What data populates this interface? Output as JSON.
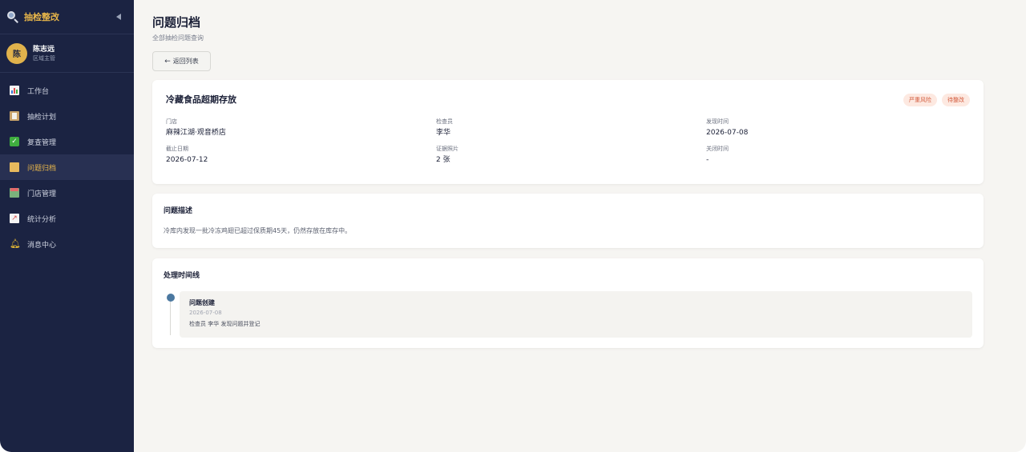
{
  "app": {
    "title": "抽检整改"
  },
  "user": {
    "avatar_text": "陈",
    "name": "陈志远",
    "role": "区域主管"
  },
  "sidebar": {
    "items": [
      {
        "label": "工作台",
        "icon": "chart-icon",
        "active": false
      },
      {
        "label": "抽检计划",
        "icon": "clipboard-icon",
        "active": false
      },
      {
        "label": "复查管理",
        "icon": "check-icon",
        "active": false
      },
      {
        "label": "问题归档",
        "icon": "folder-icon",
        "active": true
      },
      {
        "label": "门店管理",
        "icon": "store-icon",
        "active": false
      },
      {
        "label": "统计分析",
        "icon": "trend-icon",
        "active": false
      },
      {
        "label": "消息中心",
        "icon": "bell-icon",
        "active": false
      }
    ]
  },
  "header": {
    "title": "问题归档",
    "subtitle": "全部抽检问题查询",
    "back_label": "返回列表"
  },
  "detail": {
    "title": "冷藏食品超期存放",
    "badges": [
      "严重风险",
      "待整改"
    ],
    "fields": [
      {
        "label": "门店",
        "value": "麻辣江湖·观音桥店"
      },
      {
        "label": "检查员",
        "value": "李华"
      },
      {
        "label": "发现时间",
        "value": "2026-07-08"
      },
      {
        "label": "截止日期",
        "value": "2026-07-12"
      },
      {
        "label": "证据照片",
        "value": "2 张"
      },
      {
        "label": "关闭时间",
        "value": "-"
      }
    ]
  },
  "description": {
    "title": "问题描述",
    "text": "冷库内发现一批冷冻鸡翅已超过保质期45天，仍然存放在库存中。"
  },
  "timeline": {
    "title": "处理时间线",
    "events": [
      {
        "title": "问题创建",
        "date": "2026-07-08",
        "text": "检查员 李华 发现问题并登记"
      }
    ]
  },
  "colors": {
    "sidebar_bg": "#1b2342",
    "accent": "#e8b64a",
    "badge_text": "#d25a3c",
    "badge_bg": "#fde9e1",
    "timeline_dot": "#4b78a0"
  }
}
